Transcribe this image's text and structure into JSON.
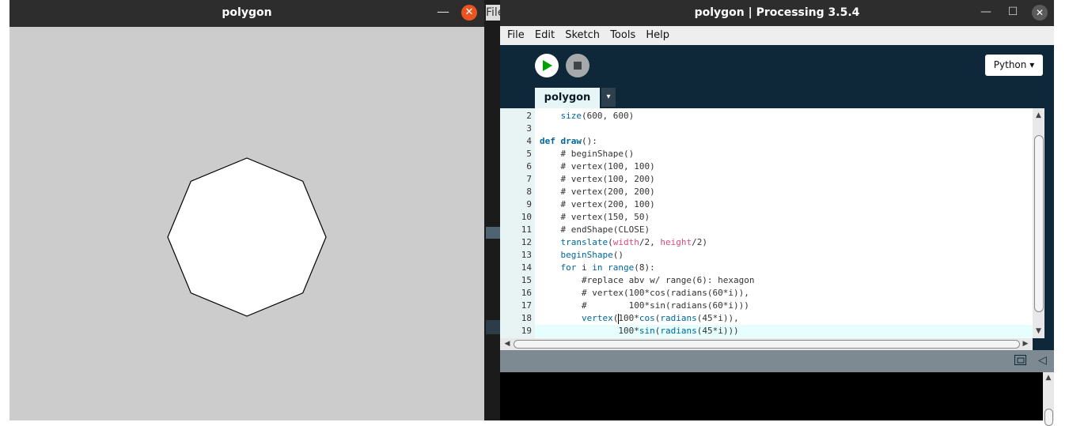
{
  "sketch_window": {
    "title": "polygon",
    "minimize_glyph": "—",
    "close_glyph": "✕",
    "canvas_color": "#cccccc",
    "polygon_sides": 8,
    "polygon_radius": 100
  },
  "gap": {
    "file_label": "File"
  },
  "ide_window": {
    "title": "polygon | Processing 3.5.4",
    "minimize_glyph": "—",
    "maximize_glyph": "☐",
    "close_glyph": "✕",
    "menu": [
      "File",
      "Edit",
      "Sketch",
      "Tools",
      "Help"
    ],
    "mode_label": "Python ▾",
    "tab_label": "polygon",
    "tab_menu_glyph": "▾",
    "colors": {
      "toolbar_bg": "#0e2739",
      "run_icon": "#00a000",
      "keyword": "#006699",
      "constant": "#d94a7a",
      "line_highlight": "#e6fffe"
    }
  },
  "editor": {
    "line_numbers": [
      "2",
      "3",
      "4",
      "5",
      "6",
      "7",
      "8",
      "9",
      "10",
      "11",
      "12",
      "13",
      "14",
      "15",
      "16",
      "17",
      "18",
      "19"
    ],
    "lines": [
      [
        {
          "t": "    "
        },
        {
          "t": "size",
          "c": "fn"
        },
        {
          "t": "(600, 600)"
        }
      ],
      [],
      [
        {
          "t": "def ",
          "c": "kw"
        },
        {
          "t": "draw",
          "c": "kw"
        },
        {
          "t": "():"
        }
      ],
      [
        {
          "t": "    # beginShape()"
        }
      ],
      [
        {
          "t": "    # vertex(100, 100)"
        }
      ],
      [
        {
          "t": "    # vertex(100, 200)"
        }
      ],
      [
        {
          "t": "    # vertex(200, 200)"
        }
      ],
      [
        {
          "t": "    # vertex(200, 100)"
        }
      ],
      [
        {
          "t": "    # vertex(150, 50)"
        }
      ],
      [
        {
          "t": "    # endShape(CLOSE)"
        }
      ],
      [
        {
          "t": "    "
        },
        {
          "t": "translate",
          "c": "fn"
        },
        {
          "t": "("
        },
        {
          "t": "width",
          "c": "cst"
        },
        {
          "t": "/2, "
        },
        {
          "t": "height",
          "c": "cst"
        },
        {
          "t": "/2)"
        }
      ],
      [
        {
          "t": "    "
        },
        {
          "t": "beginShape",
          "c": "fn"
        },
        {
          "t": "()"
        }
      ],
      [
        {
          "t": "    "
        },
        {
          "t": "for",
          "c": "fn"
        },
        {
          "t": " i "
        },
        {
          "t": "in",
          "c": "fn"
        },
        {
          "t": " "
        },
        {
          "t": "range",
          "c": "fn"
        },
        {
          "t": "(8):"
        }
      ],
      [
        {
          "t": "        #replace abv w/ range(6): hexagon"
        }
      ],
      [
        {
          "t": "        # vertex(100*cos(radians(60*i)),"
        }
      ],
      [
        {
          "t": "        #        100*sin(radians(60*i)))"
        }
      ],
      [
        {
          "t": "        "
        },
        {
          "t": "vertex",
          "c": "fn"
        },
        {
          "t": "("
        },
        {
          "cursor": true
        },
        {
          "t": "100*"
        },
        {
          "t": "cos",
          "c": "fn"
        },
        {
          "t": "("
        },
        {
          "t": "radians",
          "c": "fn"
        },
        {
          "t": "(45*i)),"
        }
      ],
      [
        {
          "t": "               100*"
        },
        {
          "t": "sin",
          "c": "fn"
        },
        {
          "t": "("
        },
        {
          "t": "radians",
          "c": "fn"
        },
        {
          "t": "(45*i)))"
        }
      ]
    ],
    "highlight_line_index": 17
  }
}
